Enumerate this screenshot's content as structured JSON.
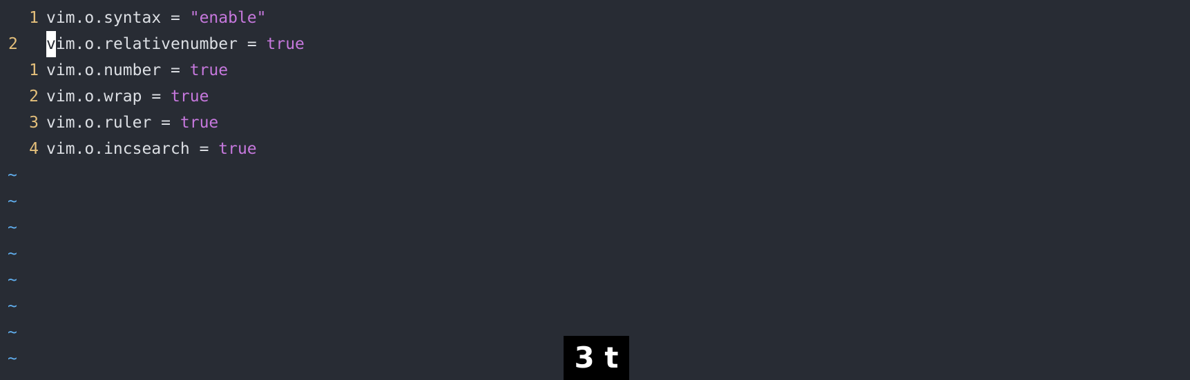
{
  "editor": {
    "lines": [
      {
        "number": "1",
        "current": false,
        "prop": "vim.o.syntax",
        "op": " = ",
        "value": "\"enable\"",
        "value_type": "string"
      },
      {
        "number": "2",
        "current": true,
        "cursor_char": "v",
        "prop_rest": "im.o.relativenumber",
        "op": " = ",
        "value": "true",
        "value_type": "bool"
      },
      {
        "number": "1",
        "current": false,
        "prop": "vim.o.number",
        "op": " = ",
        "value": "true",
        "value_type": "bool"
      },
      {
        "number": "2",
        "current": false,
        "prop": "vim.o.wrap",
        "op": " = ",
        "value": "true",
        "value_type": "bool"
      },
      {
        "number": "3",
        "current": false,
        "prop": "vim.o.ruler",
        "op": " = ",
        "value": "true",
        "value_type": "bool"
      },
      {
        "number": "4",
        "current": false,
        "prop": "vim.o.incsearch",
        "op": " = ",
        "value": "true",
        "value_type": "bool"
      }
    ],
    "filler": [
      "~",
      "~",
      "~",
      "~",
      "~",
      "~",
      "~",
      "~"
    ]
  },
  "keys_overlay": {
    "text": "3 t"
  },
  "colors": {
    "background": "#282c34",
    "line_number": "#e5c07b",
    "text": "#dcdfe4",
    "keyword": "#c678dd",
    "tilde": "#61afef",
    "cursor": "#ffffff"
  }
}
